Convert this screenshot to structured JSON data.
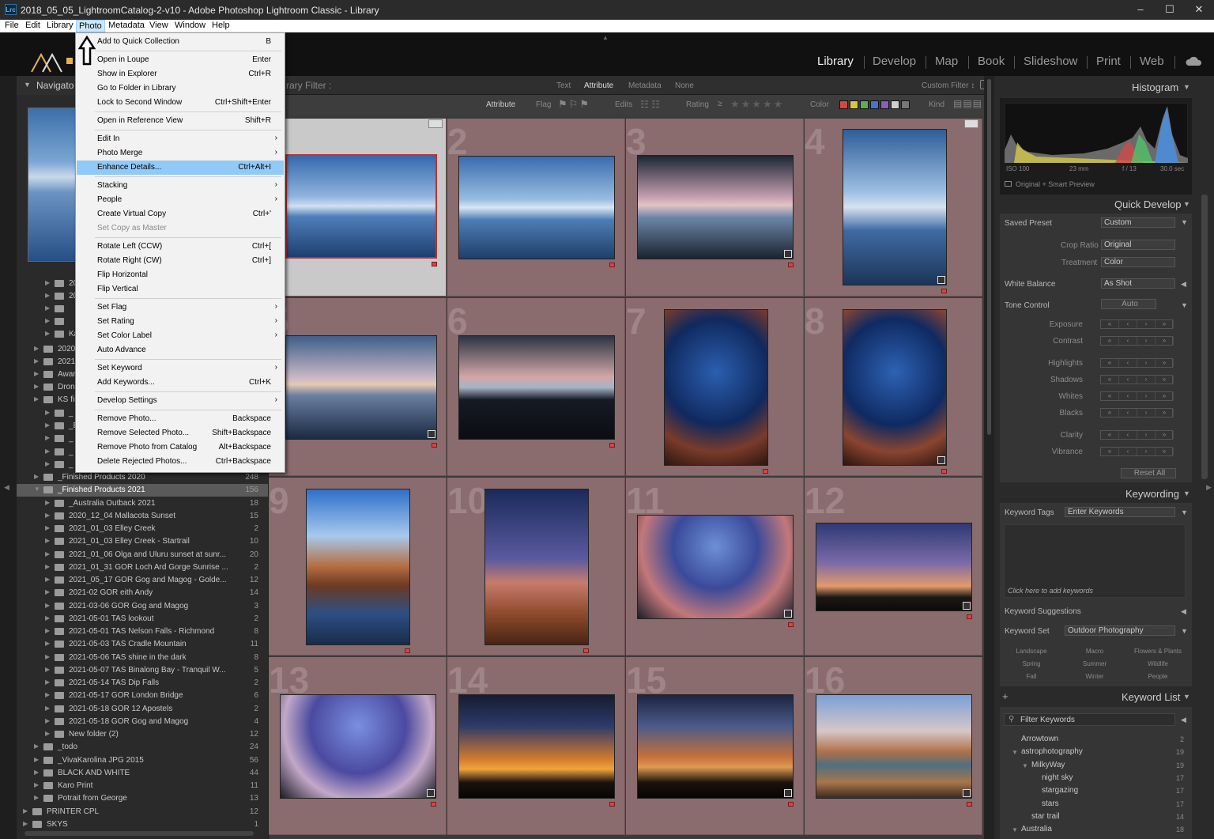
{
  "window": {
    "title": "2018_05_05_LightroomCatalog-2-v10 - Adobe Photoshop Lightroom Classic - Library",
    "app_icon": "Lrc",
    "controls": [
      "minimize",
      "maximize",
      "close"
    ]
  },
  "menubar": [
    "File",
    "Edit",
    "Library",
    "Photo",
    "Metadata",
    "View",
    "Window",
    "Help"
  ],
  "modules": [
    "Library",
    "Develop",
    "Map",
    "Book",
    "Slideshow",
    "Print",
    "Web"
  ],
  "photo_menu": {
    "items": [
      {
        "label": "Add to Quick Collection",
        "shortcut": "B"
      },
      {
        "sep": true
      },
      {
        "label": "Open in Loupe",
        "shortcut": "Enter"
      },
      {
        "label": "Show in Explorer",
        "shortcut": "Ctrl+R"
      },
      {
        "label": "Go to Folder in Library",
        "shortcut": ""
      },
      {
        "label": "Lock to Second Window",
        "shortcut": "Ctrl+Shift+Enter"
      },
      {
        "sep": true
      },
      {
        "label": "Open in Reference View",
        "shortcut": "Shift+R"
      },
      {
        "sep": true
      },
      {
        "label": "Edit In",
        "submenu": true
      },
      {
        "label": "Photo Merge",
        "submenu": true
      },
      {
        "label": "Enhance Details...",
        "shortcut": "Ctrl+Alt+I",
        "highlight": true
      },
      {
        "sep": true
      },
      {
        "label": "Stacking",
        "submenu": true
      },
      {
        "label": "People",
        "submenu": true
      },
      {
        "label": "Create Virtual Copy",
        "shortcut": "Ctrl+'"
      },
      {
        "label": "Set Copy as Master",
        "shortcut": "",
        "disabled": true
      },
      {
        "sep": true
      },
      {
        "label": "Rotate Left (CCW)",
        "shortcut": "Ctrl+["
      },
      {
        "label": "Rotate Right (CW)",
        "shortcut": "Ctrl+]"
      },
      {
        "label": "Flip Horizontal",
        "shortcut": ""
      },
      {
        "label": "Flip Vertical",
        "shortcut": ""
      },
      {
        "sep": true
      },
      {
        "label": "Set Flag",
        "submenu": true
      },
      {
        "label": "Set Rating",
        "submenu": true
      },
      {
        "label": "Set Color Label",
        "submenu": true
      },
      {
        "label": "Auto Advance",
        "shortcut": ""
      },
      {
        "sep": true
      },
      {
        "label": "Set Keyword",
        "submenu": true
      },
      {
        "label": "Add Keywords...",
        "shortcut": "Ctrl+K"
      },
      {
        "sep": true
      },
      {
        "label": "Develop Settings",
        "submenu": true
      },
      {
        "sep": true
      },
      {
        "label": "Remove Photo...",
        "shortcut": "Backspace"
      },
      {
        "label": "Remove Selected Photo...",
        "shortcut": "Shift+Backspace"
      },
      {
        "label": "Remove Photo from Catalog",
        "shortcut": "Alt+Backspace"
      },
      {
        "label": "Delete Rejected Photos...",
        "shortcut": "Ctrl+Backspace"
      }
    ]
  },
  "left_panel": {
    "navigator_label": "Navigato",
    "partial_rows": [
      {
        "name": "20",
        "count": ""
      },
      {
        "name": "20",
        "count": ""
      },
      {
        "name": "",
        "count": ""
      },
      {
        "name": "",
        "count": ""
      },
      {
        "name": "Ka",
        "count": ""
      },
      {
        "name": "2020",
        "count": ""
      },
      {
        "name": "2021",
        "count": ""
      },
      {
        "name": "Awar",
        "count": ""
      },
      {
        "name": "Dron",
        "count": ""
      },
      {
        "name": "KS fir",
        "count": ""
      },
      {
        "name": "_",
        "count": ""
      },
      {
        "name": "_E",
        "count": ""
      },
      {
        "name": "_",
        "count": ""
      },
      {
        "name": "_",
        "count": ""
      },
      {
        "name": "_",
        "count": ""
      }
    ],
    "folders": [
      {
        "name": "_Finished Products 2020",
        "count": "248",
        "indent": 1
      },
      {
        "name": "_Finished Products 2021",
        "count": "156",
        "indent": 1,
        "selected": true
      },
      {
        "name": "_Australia Outback 2021",
        "count": "18",
        "indent": 2
      },
      {
        "name": "2020_12_04 Mallacota Sunset",
        "count": "15",
        "indent": 2
      },
      {
        "name": "2021_01_03 Elley Creek",
        "count": "2",
        "indent": 2
      },
      {
        "name": "2021_01_03 Elley Creek - Startrail",
        "count": "10",
        "indent": 2
      },
      {
        "name": "2021_01_06 Olga and Uluru sunset at sunr...",
        "count": "20",
        "indent": 2
      },
      {
        "name": "2021_01_31 GOR Loch Ard Gorge Sunrise ...",
        "count": "2",
        "indent": 2
      },
      {
        "name": "2021_05_17 GOR Gog and Magog - Golde...",
        "count": "12",
        "indent": 2
      },
      {
        "name": "2021-02 GOR eith Andy",
        "count": "14",
        "indent": 2
      },
      {
        "name": "2021-03-06 GOR Gog and Magog",
        "count": "3",
        "indent": 2
      },
      {
        "name": "2021-05-01 TAS lookout",
        "count": "2",
        "indent": 2
      },
      {
        "name": "2021-05-01 TAS Nelson Falls - Richmond",
        "count": "8",
        "indent": 2
      },
      {
        "name": "2021-05-03 TAS Cradle Mountain",
        "count": "11",
        "indent": 2
      },
      {
        "name": "2021-05-06 TAS shine in the dark",
        "count": "8",
        "indent": 2
      },
      {
        "name": "2021-05-07 TAS Binalong Bay - Tranquil W...",
        "count": "5",
        "indent": 2
      },
      {
        "name": "2021-05-14 TAS Dip Falls",
        "count": "2",
        "indent": 2
      },
      {
        "name": "2021-05-17 GOR London Bridge",
        "count": "6",
        "indent": 2
      },
      {
        "name": "2021-05-18 GOR 12 Apostels",
        "count": "2",
        "indent": 2
      },
      {
        "name": "2021-05-18 GOR Gog and Magog",
        "count": "4",
        "indent": 2
      },
      {
        "name": "New folder (2)",
        "count": "12",
        "indent": 2
      },
      {
        "name": "_todo",
        "count": "24",
        "indent": 1
      },
      {
        "name": "_VivaKarolina JPG 2015",
        "count": "56",
        "indent": 1
      },
      {
        "name": "BLACK AND WHITE",
        "count": "44",
        "indent": 1
      },
      {
        "name": "Karo Print",
        "count": "11",
        "indent": 1
      },
      {
        "name": "Potrait from George",
        "count": "13",
        "indent": 1
      },
      {
        "name": "PRINTER CPL",
        "count": "12",
        "indent": 0
      },
      {
        "name": "SKYS",
        "count": "1",
        "indent": 0
      }
    ]
  },
  "filter_bar": {
    "title": "rary Filter :",
    "tabs": [
      "Text",
      "Attribute",
      "Metadata",
      "None"
    ],
    "custom": "Custom Filter ↕",
    "attribute_labels": [
      "Attribute",
      "Flag",
      "Edits",
      "Rating",
      "≥",
      "Color",
      "Kind"
    ]
  },
  "grid": {
    "numbers": [
      "1",
      "2",
      "3",
      "4",
      "5",
      "6",
      "7",
      "8",
      "9",
      "10",
      "11",
      "12",
      "13",
      "14",
      "15",
      "16"
    ]
  },
  "right_panel": {
    "histogram": {
      "title": "Histogram",
      "iso": "ISO 100",
      "focal": "23 mm",
      "aperture": "f / 13",
      "shutter": "30.0 sec",
      "preview": "Original + Smart Preview"
    },
    "quick_develop": {
      "title": "Quick Develop",
      "saved_preset_label": "Saved Preset",
      "saved_preset": "Custom",
      "crop_label": "Crop Ratio",
      "crop": "Original",
      "treatment_label": "Treatment",
      "treatment": "Color",
      "wb_label": "White Balance",
      "wb": "As Shot",
      "tone_label": "Tone Control",
      "auto": "Auto",
      "sliders": [
        "Exposure",
        "Contrast",
        "Highlights",
        "Shadows",
        "Whites",
        "Blacks",
        "Clarity",
        "Vibrance"
      ],
      "reset": "Reset All"
    },
    "keywording": {
      "title": "Keywording",
      "tags_label": "Keyword Tags",
      "tags_value": "Enter Keywords",
      "placeholder": "Click here to add keywords",
      "suggestions": "Keyword Suggestions",
      "set_label": "Keyword Set",
      "set_value": "Outdoor Photography",
      "set_words": [
        "Landscape",
        "Macro",
        "Flowers & Plants",
        "Spring",
        "Summer",
        "Wildlife",
        "Fall",
        "Winter",
        "People"
      ]
    },
    "keyword_list": {
      "title": "Keyword List",
      "filter": "Filter Keywords",
      "items": [
        {
          "name": "Arrowtown",
          "count": "2",
          "indent": 0
        },
        {
          "name": "astrophotography",
          "count": "19",
          "indent": 0
        },
        {
          "name": "MilkyWay",
          "count": "19",
          "indent": 1
        },
        {
          "name": "night sky",
          "count": "17",
          "indent": 2
        },
        {
          "name": "stargazing",
          "count": "17",
          "indent": 2
        },
        {
          "name": "stars",
          "count": "17",
          "indent": 2
        },
        {
          "name": "star trail",
          "count": "14",
          "indent": 1
        },
        {
          "name": "Australia",
          "count": "18",
          "indent": 0
        }
      ]
    }
  },
  "colors": {
    "accent": "#91c9f7",
    "grid_bg": "#8a6b6e",
    "label_red": "#d84545"
  }
}
